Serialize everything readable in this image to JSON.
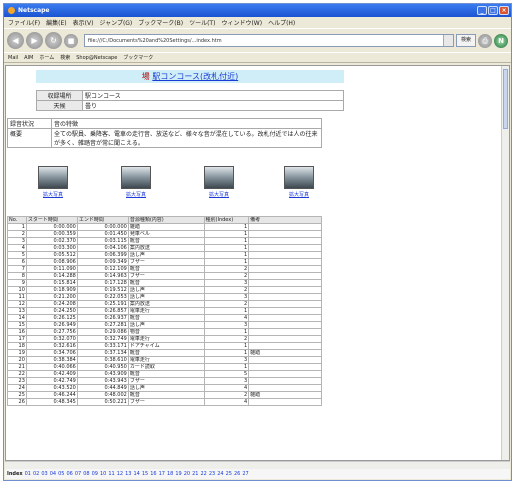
{
  "window": {
    "title": "Netscape"
  },
  "menu": [
    "ファイル(F)",
    "編集(E)",
    "表示(V)",
    "ジャンプ(G)",
    "ブックマーク(B)",
    "ツール(T)",
    "ウィンドウ(W)",
    "ヘルプ(H)"
  ],
  "toolbar": {
    "url": "file:///C:/Documents%20and%20Settings/...index.htm",
    "search_label": "検索"
  },
  "bookmarks": [
    "Mail",
    "AIM",
    "ホーム",
    "検索",
    "Shop@Netscape",
    "ブックマーク"
  ],
  "page": {
    "title_prefix": "場",
    "title_link": "駅コンコース(改札付近)",
    "info": [
      {
        "key": "収録場所",
        "value": "駅コンコース"
      },
      {
        "key": "天候",
        "value": "曇り"
      }
    ],
    "notes_header": {
      "key": "録音状況",
      "value": "音の特徴"
    },
    "notes_row": {
      "key": "概要",
      "value": "全ての駅員、乗降客、電車の走行音、放送など、様々な音が混在している。改札付近では人の往来が多く、雑踏音が常に聞こえる。"
    },
    "photos": [
      {
        "caption": "拡大写真"
      },
      {
        "caption": "拡大写真"
      },
      {
        "caption": "拡大写真"
      },
      {
        "caption": "拡大写真"
      }
    ]
  },
  "table": {
    "headers": [
      "No.",
      "スタート時間",
      "エンド時間",
      "音源種類(内容)",
      "種別(Index)",
      "備考"
    ],
    "rows": [
      [
        "1",
        "0:00.000",
        "0:00.000",
        "雑踏",
        "1",
        ""
      ],
      [
        "2",
        "0:00.359",
        "0:01.450",
        "発車ベル",
        "1",
        ""
      ],
      [
        "3",
        "0:02.370",
        "0:03.115",
        "靴音",
        "1",
        ""
      ],
      [
        "4",
        "0:03.300",
        "0:04.106",
        "案内放送",
        "1",
        ""
      ],
      [
        "5",
        "0:05.512",
        "0:06.399",
        "話し声",
        "1",
        ""
      ],
      [
        "6",
        "0:08.906",
        "0:09.349",
        "ブザー",
        "1",
        ""
      ],
      [
        "7",
        "0:11.090",
        "0:12.109",
        "靴音",
        "2",
        ""
      ],
      [
        "8",
        "0:14.288",
        "0:14.963",
        "ブザー",
        "2",
        ""
      ],
      [
        "9",
        "0:15.814",
        "0:17.128",
        "靴音",
        "3",
        ""
      ],
      [
        "10",
        "0:18.909",
        "0:19.512",
        "話し声",
        "2",
        ""
      ],
      [
        "11",
        "0:21.200",
        "0:22.053",
        "話し声",
        "3",
        ""
      ],
      [
        "12",
        "0:24.208",
        "0:25.191",
        "案内放送",
        "2",
        ""
      ],
      [
        "13",
        "0:24.250",
        "0:26.857",
        "電車走行",
        "1",
        ""
      ],
      [
        "14",
        "0:26.125",
        "0:26.937",
        "靴音",
        "4",
        ""
      ],
      [
        "15",
        "0:26.949",
        "0:27.281",
        "話し声",
        "3",
        ""
      ],
      [
        "16",
        "0:27.756",
        "0:29.086",
        "物音",
        "1",
        ""
      ],
      [
        "17",
        "0:32.070",
        "0:32.749",
        "電車走行",
        "2",
        ""
      ],
      [
        "18",
        "0:32.616",
        "0:33.171",
        "ドアチャイム",
        "1",
        ""
      ],
      [
        "19",
        "0:34.706",
        "0:37.134",
        "靴音",
        "1",
        "雑踏"
      ],
      [
        "20",
        "0:38.384",
        "0:38.610",
        "電車走行",
        "3",
        ""
      ],
      [
        "21",
        "0:40.066",
        "0:40.950",
        "カード読取",
        "1",
        ""
      ],
      [
        "22",
        "0:42.409",
        "0:43.909",
        "靴音",
        "5",
        ""
      ],
      [
        "23",
        "0:42.749",
        "0:43.943",
        "ブザー",
        "3",
        ""
      ],
      [
        "24",
        "0:43.520",
        "0:44.849",
        "話し声",
        "4",
        ""
      ],
      [
        "25",
        "0:46.244",
        "0:48.002",
        "靴音",
        "2",
        "雑踏"
      ],
      [
        "26",
        "0:48.345",
        "0:50.221",
        "ブザー",
        "4",
        ""
      ]
    ]
  },
  "index": {
    "label": "Index",
    "items": [
      "01",
      "02",
      "03",
      "04",
      "05",
      "06",
      "07",
      "08",
      "09",
      "10",
      "11",
      "12",
      "13",
      "14",
      "15",
      "16",
      "17",
      "18",
      "19",
      "20",
      "21",
      "22",
      "23",
      "24",
      "25",
      "26",
      "27"
    ]
  }
}
